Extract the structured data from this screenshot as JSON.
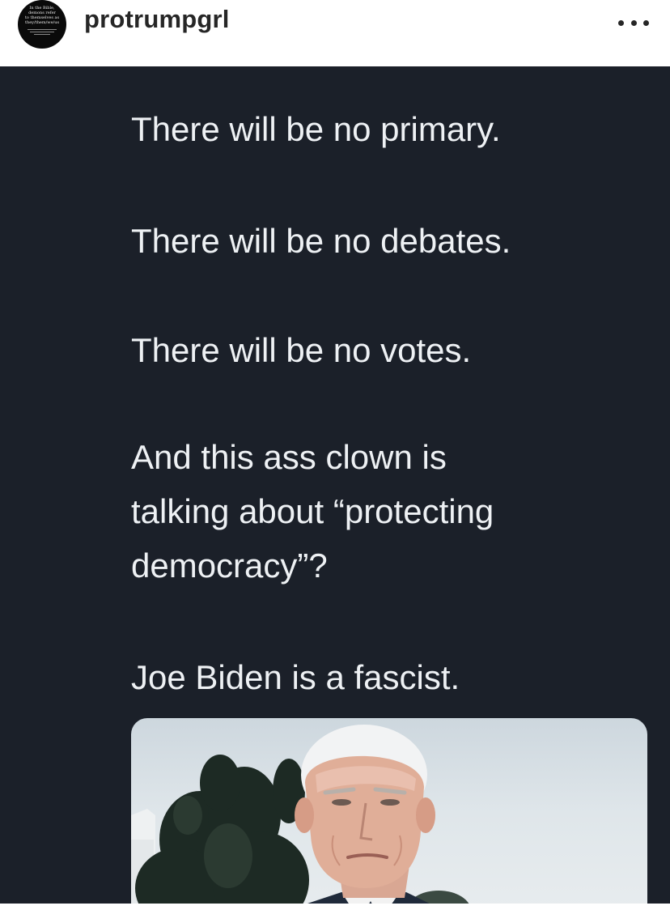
{
  "post": {
    "avatar_text": "In the Bible,\ndemons refer\nto themselves as\nthey/them/we/us",
    "username": "protrumpgrl",
    "more_icon": "more-horizontal-icon"
  },
  "tweet": {
    "lines": [
      "There will be no primary.",
      "There will be no debates.",
      "There will be no votes.",
      "And this ass clown is",
      "talking about “protecting",
      "democracy”?",
      "Joe Biden is a fascist."
    ]
  },
  "colors": {
    "panel_bg": "#1b2029",
    "tweet_text": "#eef1f4",
    "username": "#262626"
  }
}
